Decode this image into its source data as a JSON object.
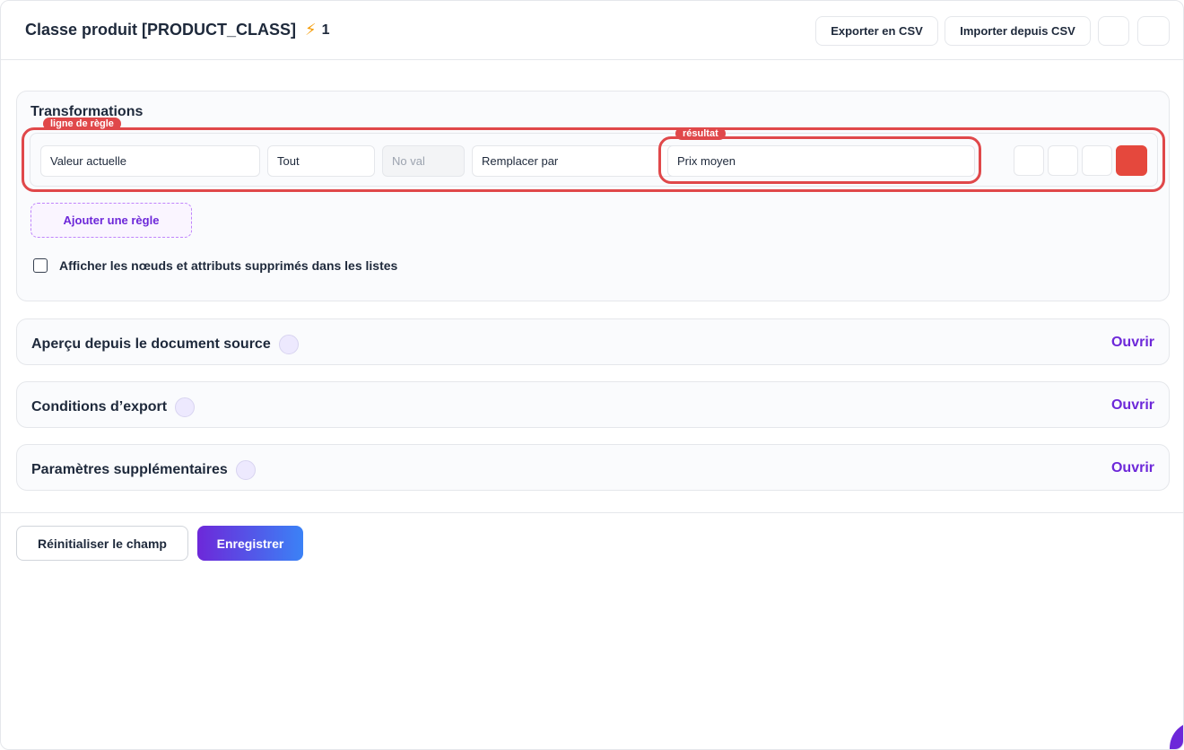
{
  "header": {
    "title": "Classe produit [PRODUCT_CLASS]",
    "bolt_icon": "lightning-icon",
    "count": "1",
    "export_csv_label": "Exporter en CSV",
    "import_csv_label": "Importer depuis CSV"
  },
  "transformations": {
    "title": "Transformations",
    "row_tag": "ligne de règle",
    "result_tag": "résultat",
    "rule": {
      "source": "Valeur actuelle",
      "scope": "Tout",
      "value_placeholder": "No val",
      "action": "Remplacer par",
      "result": "Prix moyen"
    },
    "add_rule_label": "Ajouter une règle",
    "show_deleted_label": "Afficher les nœuds et attributs supprimés dans les listes",
    "show_deleted_checked": false
  },
  "sections": [
    {
      "title": "Aperçu depuis le document source",
      "action": "Ouvrir"
    },
    {
      "title": "Conditions d’export",
      "action": "Ouvrir"
    },
    {
      "title": "Paramètres supplémentaires",
      "action": "Ouvrir"
    }
  ],
  "footer": {
    "reset_label": "Réinitialiser le champ",
    "save_label": "Enregistrer"
  },
  "colors": {
    "accent": "#6d28d9",
    "danger": "#e5483d",
    "highlight": "#e0484a"
  }
}
